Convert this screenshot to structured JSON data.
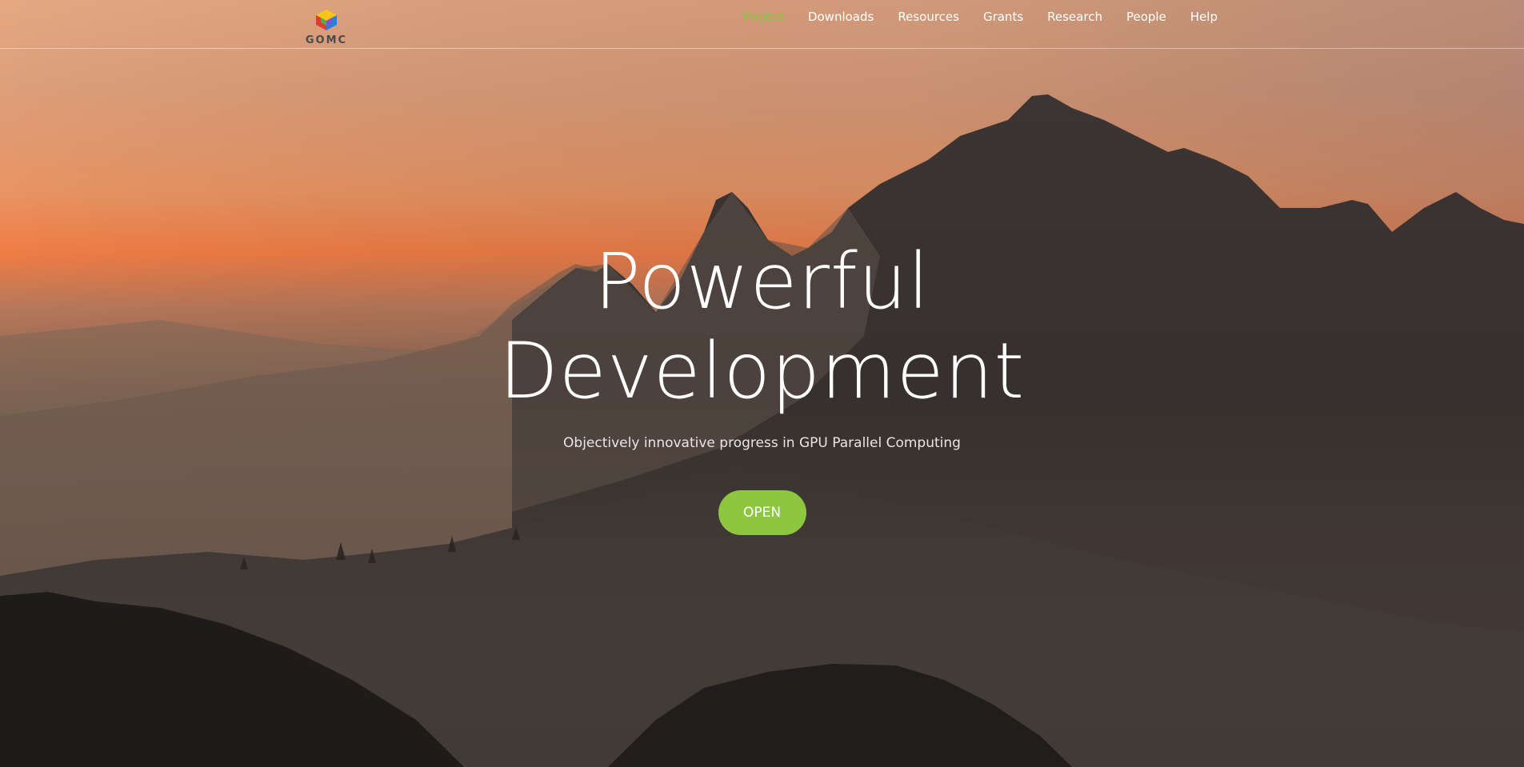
{
  "logo": {
    "text": "GOMC",
    "icon": "gomc-cube-logo"
  },
  "nav": {
    "items": [
      {
        "label": "Project",
        "active": true
      },
      {
        "label": "Downloads",
        "active": false
      },
      {
        "label": "Resources",
        "active": false
      },
      {
        "label": "Grants",
        "active": false
      },
      {
        "label": "Research",
        "active": false
      },
      {
        "label": "People",
        "active": false
      },
      {
        "label": "Help",
        "active": false
      }
    ]
  },
  "hero": {
    "title_line1": "Powerful",
    "title_line2": "Development",
    "subtitle": "Objectively innovative progress in GPU Parallel Computing",
    "cta_label": "OPEN"
  },
  "colors": {
    "accent": "#8dc63f",
    "sky_top": "#e9a77f",
    "sky_glow": "#f0783f",
    "mountain_dark": "#2a2624"
  }
}
